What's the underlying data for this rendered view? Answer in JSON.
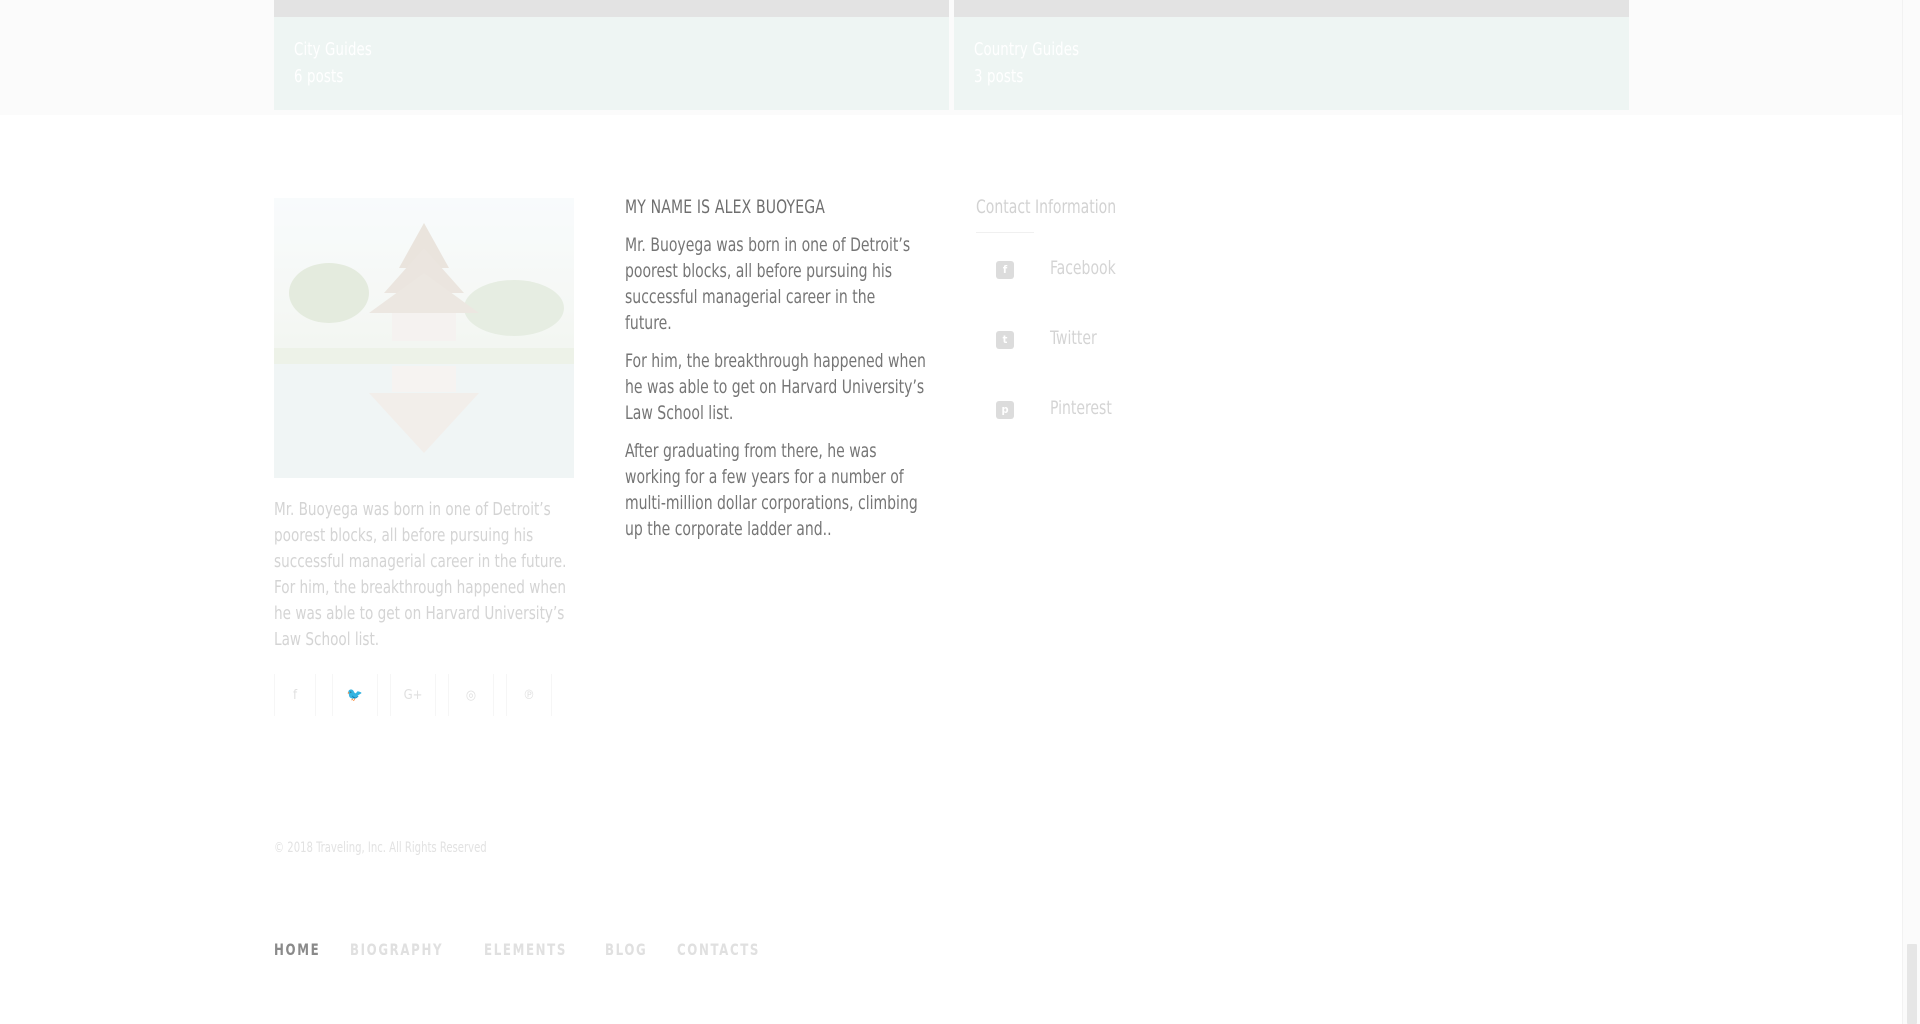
{
  "categories": [
    {
      "name": "City Guides",
      "count": "6 posts"
    },
    {
      "name": "Country Guides",
      "count": "3 posts"
    }
  ],
  "about": {
    "image_alt": "temple by the lake",
    "text": "Mr. Buoyega was born in one of Detroit’s poorest blocks, all before pursuing his successful managerial career in the future. For him, the breakthrough happened when he was able to get on Harvard University’s Law School list.",
    "social": [
      {
        "icon": "facebook-icon",
        "glyph": "f"
      },
      {
        "icon": "twitter-icon",
        "glyph": "🐦"
      },
      {
        "icon": "google-plus-icon",
        "glyph": "G+"
      },
      {
        "icon": "instagram-icon",
        "glyph": "◎"
      },
      {
        "icon": "pinterest-icon",
        "glyph": "℗"
      }
    ]
  },
  "bio": {
    "title": "MY NAME IS ALEX BUOYEGA",
    "paragraphs": [
      "Mr. Buoyega was born in one of Detroit’s poorest blocks, all before pursuing his successful managerial career in the future.",
      "For him, the breakthrough happened when he was able to get on Harvard University’s Law School list.",
      "After graduating from there, he was working for a few years for a number of multi-million dollar corporations, climbing up the corporate ladder and.."
    ]
  },
  "contact": {
    "title": "Contact Information",
    "items": [
      {
        "label": "Facebook",
        "icon": "facebook-icon",
        "glyph": "f"
      },
      {
        "label": "Twitter",
        "icon": "twitter-icon",
        "glyph": "t"
      },
      {
        "label": "Pinterest",
        "icon": "pinterest-icon",
        "glyph": "p"
      }
    ]
  },
  "copyright": "© 2018 Traveling, Inc. All Rights Reserved",
  "nav": [
    {
      "label": "HOME",
      "active": true
    },
    {
      "label": "BIOGRAPHY",
      "active": false
    },
    {
      "label": "ELEMENTS",
      "active": false
    },
    {
      "label": "BLOG",
      "active": false
    },
    {
      "label": "CONTACTS",
      "active": false
    }
  ]
}
